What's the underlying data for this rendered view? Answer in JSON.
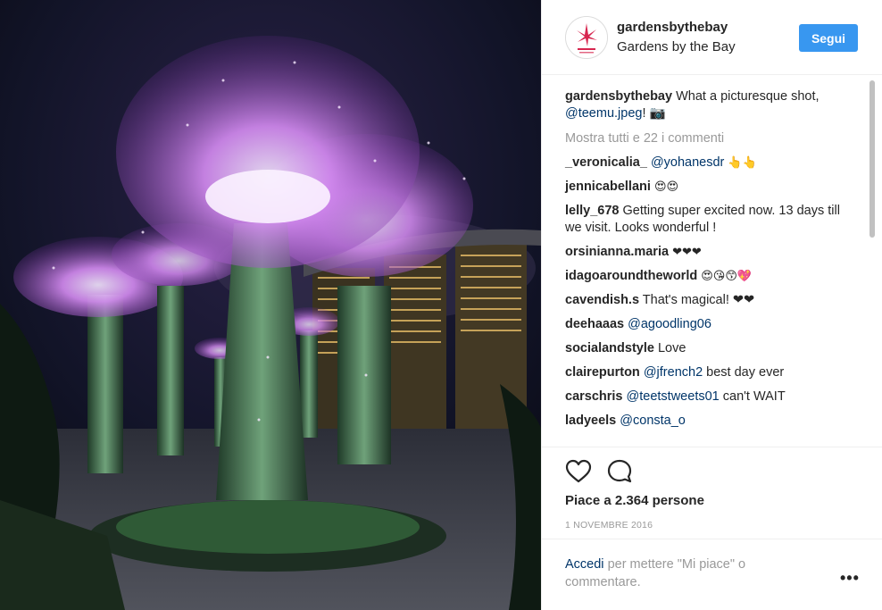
{
  "post": {
    "photo_subject": "supertree-grove-night-photo"
  },
  "header": {
    "username": "gardensbythebay",
    "full_name": "Gardens by the Bay",
    "follow_label": "Segui"
  },
  "caption": {
    "username": "gardensbythebay",
    "text_before": "What a picturesque shot,",
    "mention": "@teemu.jpeg",
    "text_after": "! 📷"
  },
  "view_all_comments": "Mostra tutti e 22 i commenti",
  "comments": [
    {
      "username": "_veronicalia_",
      "mention": "@yohanesdr",
      "text": "👆👆"
    },
    {
      "username": "jennicabellani",
      "mention": "",
      "text": "😍😍"
    },
    {
      "username": "lelly_678",
      "mention": "",
      "text": "Getting super excited now. 13 days till we visit. Looks wonderful !"
    },
    {
      "username": "orsinianna.maria",
      "mention": "",
      "text": "❤❤❤"
    },
    {
      "username": "idagoaroundtheworld",
      "mention": "",
      "text": "😍😘😙💖"
    },
    {
      "username": "cavendish.s",
      "mention": "",
      "text": "That's magical! ❤❤"
    },
    {
      "username": "deehaaas",
      "mention": "@agoodling06",
      "text": ""
    },
    {
      "username": "socialandstyle",
      "mention": "",
      "text": "Love"
    },
    {
      "username": "clairepurton",
      "mention": "@jfrench2",
      "text": "best day ever"
    },
    {
      "username": "carschris",
      "mention": "@teetstweets01",
      "text": "can't WAIT"
    },
    {
      "username": "ladyeels",
      "mention": "@consta_o",
      "text": ""
    }
  ],
  "likes_text": "Piace a 2.364 persone",
  "date": "1 NOVEMBRE 2016",
  "footer": {
    "login_link": "Accedi",
    "login_rest": "per mettere \"Mi piace\" o commentare.",
    "more_label": "•••"
  },
  "colors": {
    "accent_blue": "#3897f0",
    "link_dark_blue": "#003569",
    "muted_gray": "#999999",
    "supertree_purple": "#b45fd8"
  },
  "icons": {
    "like": "heart-outline-icon",
    "comment": "speech-bubble-icon",
    "more": "ellipsis-icon"
  }
}
